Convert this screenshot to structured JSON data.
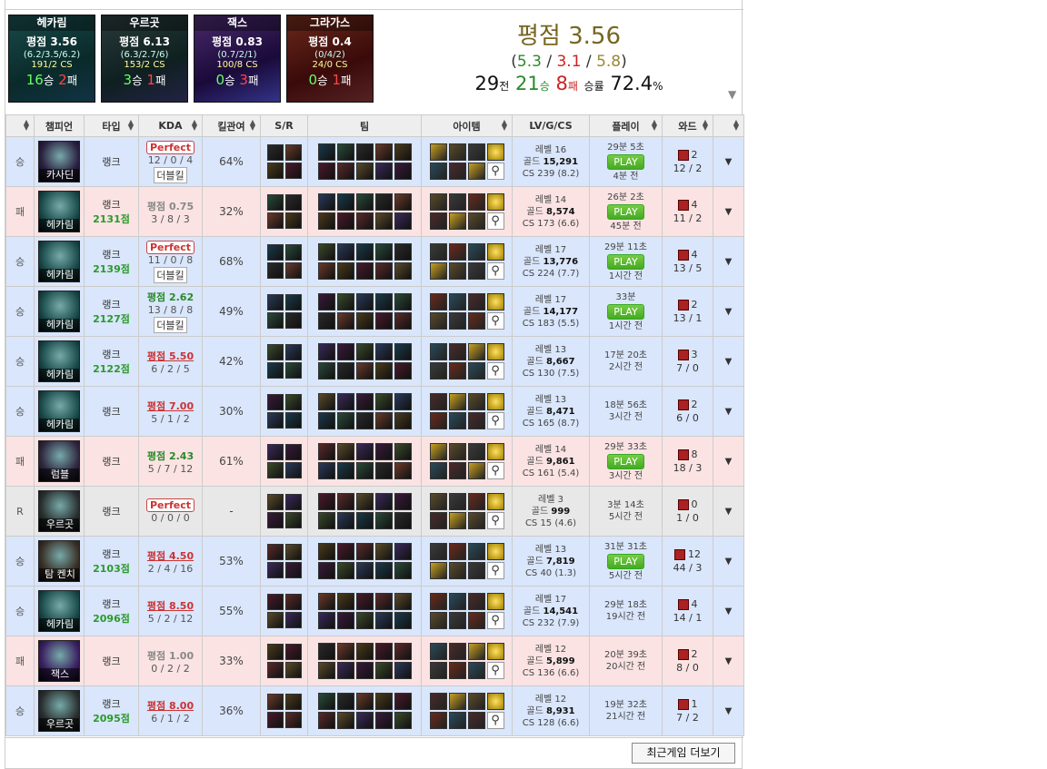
{
  "summary": {
    "champions": [
      {
        "name": "헤카림",
        "rating": "평점 3.56",
        "kda": "(6.2/3.5/6.2)",
        "cs": "191/2 CS",
        "wins": "16",
        "losses": "2",
        "win_word": "승",
        "loss_word": "패",
        "color": "#1a4a4a"
      },
      {
        "name": "우르곳",
        "rating": "평점 6.13",
        "kda": "(6.3/2.7/6)",
        "cs": "153/2 CS",
        "wins": "3",
        "losses": "1",
        "win_word": "승",
        "loss_word": "패",
        "color": "#2a3a3a"
      },
      {
        "name": "잭스",
        "rating": "평점 0.83",
        "kda": "(0.7/2/1)",
        "cs": "100/8 CS",
        "wins": "0",
        "losses": "3",
        "win_word": "승",
        "loss_word": "패",
        "color": "#4a2a6a"
      },
      {
        "name": "그라가스",
        "rating": "평점 0.4",
        "kda": "(0/4/2)",
        "cs": "24/0 CS",
        "wins": "0",
        "losses": "1",
        "win_word": "승",
        "loss_word": "패",
        "color": "#6a2a1a"
      }
    ],
    "overall_rating": "평점 3.56",
    "kda": {
      "k": "5.3",
      "d": "3.1",
      "a": "5.8"
    },
    "games": "29",
    "games_word": "전",
    "wins": "21",
    "wins_word": "승",
    "losses": "8",
    "losses_word": "패",
    "winrate_label": "승률",
    "winrate": "72.4",
    "winrate_unit": "%"
  },
  "headers": {
    "result": "",
    "champion": "챔피언",
    "type": "타입",
    "kda": "KDA",
    "kp": "킬관여",
    "sr": "S/R",
    "team": "팀",
    "items": "아이템",
    "lv": "LV/G/CS",
    "play": "플레이",
    "ward": "와드",
    "exp": ""
  },
  "games": [
    {
      "result": "승",
      "cls": "win",
      "champ": "카사딘",
      "type": "랭크",
      "points": "",
      "badge": "Perfect",
      "rate": "",
      "line": "12 / 0 / 4",
      "multi": "더블킬",
      "kp": "64%",
      "level": "레벨 16",
      "gold": "15,291",
      "cs": "CS 239 (8.2)",
      "time": "29분 5초",
      "play": true,
      "ago": "4분 전",
      "wards": "2",
      "wardline": "12 / 2",
      "cc": "#2a2040"
    },
    {
      "result": "패",
      "cls": "loss",
      "champ": "헤카림",
      "type": "랭크",
      "points": "2131점",
      "badge": "",
      "rate": "평점 0.75",
      "line": "3 / 8 / 3",
      "multi": "",
      "kp": "32%",
      "level": "레벨 14",
      "gold": "8,574",
      "cs": "CS 173 (6.6)",
      "time": "26분 2초",
      "play": true,
      "ago": "45분 전",
      "wards": "4",
      "wardline": "11 / 2",
      "cc": "#1a4a4a"
    },
    {
      "result": "승",
      "cls": "win",
      "champ": "헤카림",
      "type": "랭크",
      "points": "2139점",
      "badge": "Perfect",
      "rate": "",
      "line": "11 / 0 / 8",
      "multi": "더블킬",
      "kp": "68%",
      "level": "레벨 17",
      "gold": "13,776",
      "cs": "CS 224 (7.7)",
      "time": "29분 11초",
      "play": true,
      "ago": "1시간 전",
      "wards": "4",
      "wardline": "13 / 5",
      "cc": "#1a4a4a"
    },
    {
      "result": "승",
      "cls": "win",
      "champ": "헤카림",
      "type": "랭크",
      "points": "2127점",
      "badge": "",
      "rate": "평점 2.62",
      "line": "13 / 8 / 8",
      "multi": "더블킬",
      "kp": "49%",
      "level": "레벨 17",
      "gold": "14,177",
      "cs": "CS 183 (5.5)",
      "time": "33분",
      "play": true,
      "ago": "1시간 전",
      "wards": "2",
      "wardline": "13 / 1",
      "cc": "#1a4a4a",
      "ratecls": "mid"
    },
    {
      "result": "승",
      "cls": "win",
      "champ": "헤카림",
      "type": "랭크",
      "points": "2122점",
      "badge": "",
      "rate": "평점 5.50",
      "line": "6 / 2 / 5",
      "multi": "",
      "kp": "42%",
      "level": "레벨 13",
      "gold": "8,667",
      "cs": "CS 130 (7.5)",
      "time": "17분 20초",
      "play": false,
      "ago": "2시간 전",
      "wards": "3",
      "wardline": "7 / 0",
      "cc": "#1a4a4a",
      "ratecls": "hi"
    },
    {
      "result": "승",
      "cls": "win",
      "champ": "헤카림",
      "type": "랭크",
      "points": "",
      "badge": "",
      "rate": "평점 7.00",
      "line": "5 / 1 / 2",
      "multi": "",
      "kp": "30%",
      "level": "레벨 13",
      "gold": "8,471",
      "cs": "CS 165 (8.7)",
      "time": "18분 56초",
      "play": false,
      "ago": "3시간 전",
      "wards": "2",
      "wardline": "6 / 0",
      "cc": "#1a4a4a",
      "ratecls": "hi"
    },
    {
      "result": "패",
      "cls": "loss",
      "champ": "럼블",
      "type": "랭크",
      "points": "",
      "badge": "",
      "rate": "평점 2.43",
      "line": "5 / 7 / 12",
      "multi": "",
      "kp": "61%",
      "level": "레벨 14",
      "gold": "9,861",
      "cs": "CS 161 (5.4)",
      "time": "29분 33초",
      "play": true,
      "ago": "3시간 전",
      "wards": "8",
      "wardline": "18 / 3",
      "cc": "#302840",
      "ratecls": "mid"
    },
    {
      "result": "R",
      "cls": "remake",
      "champ": "우르곳",
      "type": "랭크",
      "points": "",
      "badge": "Perfect",
      "rate": "",
      "line": "0 / 0 / 0",
      "multi": "",
      "kp": "-",
      "level": "레벨 3",
      "gold": "999",
      "cs": "CS 15 (4.6)",
      "time": "3분 14초",
      "play": false,
      "ago": "5시간 전",
      "wards": "0",
      "wardline": "1 / 0",
      "cc": "#2a3030"
    },
    {
      "result": "승",
      "cls": "win",
      "champ": "탐 켄치",
      "type": "랭크",
      "points": "2103점",
      "badge": "",
      "rate": "평점 4.50",
      "line": "2 / 4 / 16",
      "multi": "",
      "kp": "53%",
      "level": "레벨 13",
      "gold": "7,819",
      "cs": "CS 40 (1.3)",
      "time": "31분 31초",
      "play": true,
      "ago": "5시간 전",
      "wards": "12",
      "wardline": "44 / 3",
      "cc": "#3a3028",
      "ratecls": "hi"
    },
    {
      "result": "승",
      "cls": "win",
      "champ": "헤카림",
      "type": "랭크",
      "points": "2096점",
      "badge": "",
      "rate": "평점 8.50",
      "line": "5 / 2 / 12",
      "multi": "",
      "kp": "55%",
      "level": "레벨 17",
      "gold": "14,541",
      "cs": "CS 232 (7.9)",
      "time": "29분 18초",
      "play": false,
      "ago": "19시간 전",
      "wards": "4",
      "wardline": "14 / 1",
      "cc": "#1a4a4a",
      "ratecls": "hi"
    },
    {
      "result": "패",
      "cls": "loss",
      "champ": "잭스",
      "type": "랭크",
      "points": "",
      "badge": "",
      "rate": "평점 1.00",
      "line": "0 / 2 / 2",
      "multi": "",
      "kp": "33%",
      "level": "레벨 12",
      "gold": "5,899",
      "cs": "CS 136 (6.6)",
      "time": "20분 39초",
      "play": false,
      "ago": "20시간 전",
      "wards": "2",
      "wardline": "8 / 0",
      "cc": "#3a2060"
    },
    {
      "result": "승",
      "cls": "win",
      "champ": "우르곳",
      "type": "랭크",
      "points": "2095점",
      "badge": "",
      "rate": "평점 8.00",
      "line": "6 / 1 / 2",
      "multi": "",
      "kp": "36%",
      "level": "레벨 12",
      "gold": "8,931",
      "cs": "CS 128 (6.6)",
      "time": "19분 32초",
      "play": false,
      "ago": "21시간 전",
      "wards": "1",
      "wardline": "7 / 2",
      "cc": "#2a3030",
      "ratecls": "hi"
    }
  ],
  "gold_label": "골드",
  "play_label": "PLAY",
  "more_button": "최근게임 더보기",
  "expand_glyph": "▼",
  "summary_dropdown_glyph": "▼"
}
